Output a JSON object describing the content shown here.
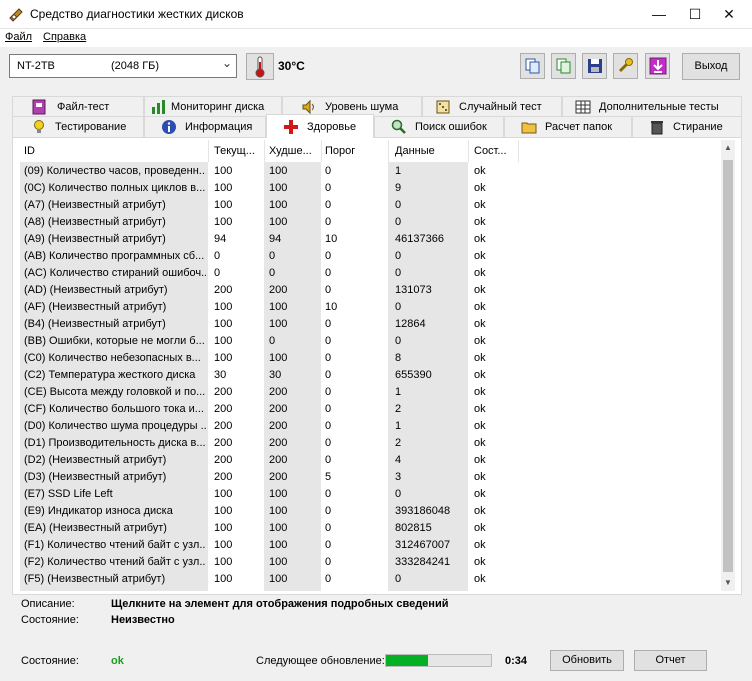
{
  "window": {
    "title": "Средство диагностики жестких дисков",
    "minimize": "—",
    "maximize": "☐",
    "close": "✕"
  },
  "menu": [
    "Файл",
    "Справка"
  ],
  "toolbar": {
    "drive_name": "NT-2TB",
    "drive_size": "(2048 ГБ)",
    "temperature": "30°C",
    "exit_label": "Выход"
  },
  "tabs_top": [
    "Файл-тест",
    "Мониторинг диска",
    "Уровень шума",
    "Случайный тест",
    "Дополнительные тесты"
  ],
  "tabs_bottom": [
    "Тестирование",
    "Информация",
    "Здоровье",
    "Поиск ошибок",
    "Расчет папок",
    "Стирание"
  ],
  "active_tab": "Здоровье",
  "table": {
    "columns": [
      "ID",
      "Текущ...",
      "Худше...",
      "Порог",
      "Данные",
      "Сост..."
    ],
    "rows": [
      [
        "(09) Количество часов, проведенн...",
        "100",
        "100",
        "0",
        "1",
        "ok"
      ],
      [
        "(0C) Количество полных циклов в...",
        "100",
        "100",
        "0",
        "9",
        "ok"
      ],
      [
        "(A7) (Неизвестный атрибут)",
        "100",
        "100",
        "0",
        "0",
        "ok"
      ],
      [
        "(A8) (Неизвестный атрибут)",
        "100",
        "100",
        "0",
        "0",
        "ok"
      ],
      [
        "(A9) (Неизвестный атрибут)",
        "94",
        "94",
        "10",
        "46137366",
        "ok"
      ],
      [
        "(AB) Количество программных сб...",
        "0",
        "0",
        "0",
        "0",
        "ok"
      ],
      [
        "(AC) Количество стираний ошибоч...",
        "0",
        "0",
        "0",
        "0",
        "ok"
      ],
      [
        "(AD) (Неизвестный атрибут)",
        "200",
        "200",
        "0",
        "131073",
        "ok"
      ],
      [
        "(AF) (Неизвестный атрибут)",
        "100",
        "100",
        "10",
        "0",
        "ok"
      ],
      [
        "(B4) (Неизвестный атрибут)",
        "100",
        "100",
        "0",
        "12864",
        "ok"
      ],
      [
        "(BB) Ошибки, которые не могли б...",
        "100",
        "0",
        "0",
        "0",
        "ok"
      ],
      [
        "(C0) Количество небезопасных в...",
        "100",
        "100",
        "0",
        "8",
        "ok"
      ],
      [
        "(C2) Температура жесткого диска",
        "30",
        "30",
        "0",
        "655390",
        "ok"
      ],
      [
        "(CE) Высота между головкой и по...",
        "200",
        "200",
        "0",
        "1",
        "ok"
      ],
      [
        "(CF) Количество большого тока и...",
        "200",
        "200",
        "0",
        "2",
        "ok"
      ],
      [
        "(D0) Количество шума процедуры ...",
        "200",
        "200",
        "0",
        "1",
        "ok"
      ],
      [
        "(D1) Производительность диска в...",
        "200",
        "200",
        "0",
        "2",
        "ok"
      ],
      [
        "(D2) (Неизвестный атрибут)",
        "200",
        "200",
        "0",
        "4",
        "ok"
      ],
      [
        "(D3) (Неизвестный атрибут)",
        "200",
        "200",
        "5",
        "3",
        "ok"
      ],
      [
        "(E7) SSD Life Left",
        "100",
        "100",
        "0",
        "0",
        "ok"
      ],
      [
        "(E9) Индикатор износа диска",
        "100",
        "100",
        "0",
        "393186048",
        "ok"
      ],
      [
        "(EA) (Неизвестный атрибут)",
        "100",
        "100",
        "0",
        "802815",
        "ok"
      ],
      [
        "(F1) Количество чтений байт с узл...",
        "100",
        "100",
        "0",
        "312467007",
        "ok"
      ],
      [
        "(F2) Количество чтений байт с узл...",
        "100",
        "100",
        "0",
        "333284241",
        "ok"
      ],
      [
        "(F5) (Неизвестный атрибут)",
        "100",
        "100",
        "0",
        "0",
        "ok"
      ]
    ]
  },
  "details": {
    "description_label": "Описание:",
    "description_value": "Щелкните на элемент для отображения подробных сведений",
    "state_label": "Состояние:",
    "state_value": "Неизвестно"
  },
  "footer": {
    "status_label": "Состояние:",
    "status_value": "ok",
    "next_update_label": "Следующее обновление:",
    "progress_fraction": 0.4,
    "countdown": "0:34",
    "refresh_label": "Обновить",
    "report_label": "Отчет"
  },
  "colors": {
    "progress_fill": "#06b025",
    "status_ok": "#1a9e1a",
    "shaded_column": "#e6e6e6"
  }
}
